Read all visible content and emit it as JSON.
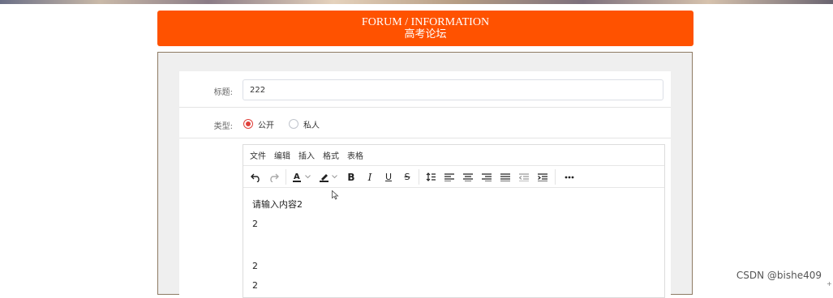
{
  "header": {
    "title_en": "FORUM / INFORMATION",
    "title_cn": "高考论坛"
  },
  "form": {
    "title_label": "标题:",
    "title_value": "222",
    "type_label": "类型:",
    "type_options": [
      {
        "label": "公开",
        "checked": true
      },
      {
        "label": "私人",
        "checked": false
      }
    ]
  },
  "editor": {
    "menu": [
      "文件",
      "编辑",
      "插入",
      "格式",
      "表格"
    ],
    "content_lines": [
      "请输入内容2",
      "2",
      "",
      "2",
      "2"
    ]
  },
  "watermark": "CSDN @bishe409",
  "colors": {
    "accent": "#ff5200",
    "radio_checked": "#e0403a"
  }
}
